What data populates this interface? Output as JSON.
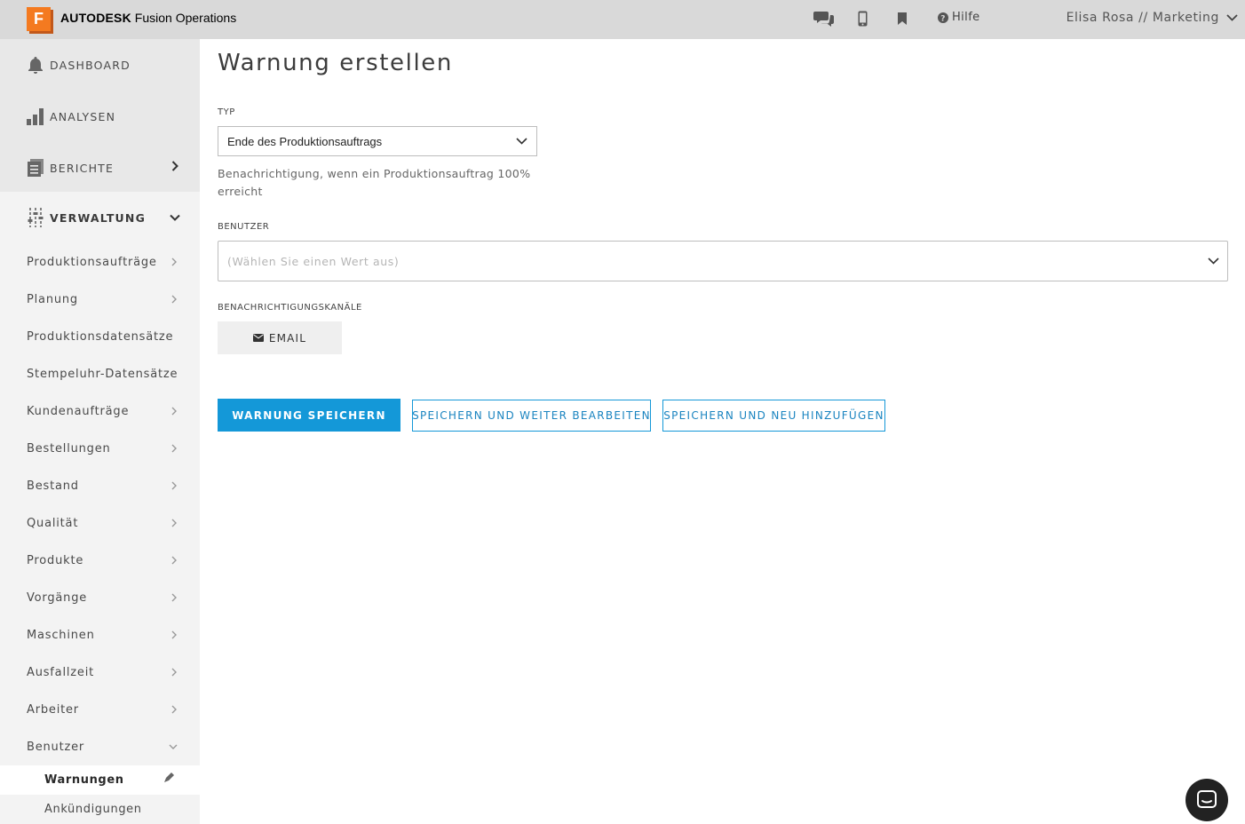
{
  "app": {
    "logo_letter": "F",
    "brand_bold": "AUTODESK",
    "brand_rest": " Fusion Operations"
  },
  "topbar": {
    "icons": [
      "chat-bubbles-icon",
      "mobile-phone-icon",
      "bookmark-icon"
    ],
    "help_label": "Hilfe",
    "user_label": "Elisa Rosa // Marketing"
  },
  "sidebar": {
    "main_items": [
      {
        "label": "DASHBOARD",
        "icon": "bell-icon"
      },
      {
        "label": "ANALYSEN",
        "icon": "bar-chart-icon"
      },
      {
        "label": "BERICHTE",
        "icon": "reports-icon"
      },
      {
        "label": "VERWALTUNG",
        "icon": "sliders-icon"
      }
    ],
    "sub_items": [
      {
        "label": "Produktionsaufträge"
      },
      {
        "label": "Planung"
      },
      {
        "label": "Produktionsdatensätze"
      },
      {
        "label": "Stempeluhr-Datensätze"
      },
      {
        "label": "Kundenaufträge"
      },
      {
        "label": "Bestellungen"
      },
      {
        "label": "Bestand"
      },
      {
        "label": "Qualität"
      },
      {
        "label": "Produkte"
      },
      {
        "label": "Vorgänge"
      },
      {
        "label": "Maschinen"
      },
      {
        "label": "Ausfallzeit"
      },
      {
        "label": "Arbeiter"
      },
      {
        "label": "Benutzer"
      }
    ],
    "benutzer_children": [
      {
        "label": "Warnungen",
        "active": true
      },
      {
        "label": "Ankündigungen",
        "active": false
      }
    ]
  },
  "form": {
    "title": "Warnung erstellen",
    "typ_label": "TYP",
    "typ_value": "Ende des Produktionsauftrags",
    "typ_hint": "Benachrichtigung, wenn ein Produktionsauftrag 100% erreicht",
    "benutzer_label": "BENUTZER",
    "benutzer_placeholder": "(Wählen Sie einen Wert aus)",
    "kanaele_label": "BENACHRICHTIGUNGSKANÄLE",
    "email_label": "EMAIL"
  },
  "actions": {
    "save": "WARNUNG SPEICHERN",
    "save_continue": "SPEICHERN UND WEITER BEARBEITEN",
    "save_add": "SPEICHERN UND NEU HINZUFÜGEN"
  },
  "colors": {
    "accent": "#1498d8",
    "brand_orange": "#f47a20",
    "topbar_bg": "#d9d9d9",
    "sidebar_bg": "#f3f3f3"
  }
}
